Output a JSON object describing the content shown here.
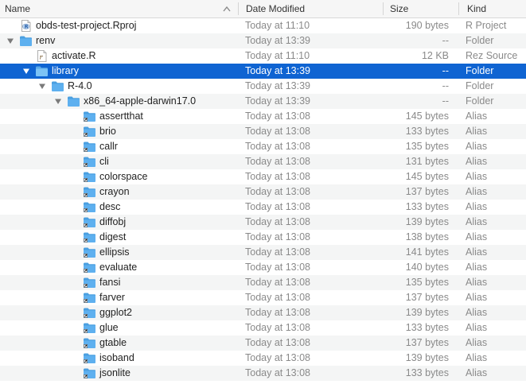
{
  "header": {
    "name": "Name",
    "date_modified": "Date Modified",
    "size": "Size",
    "kind": "Kind"
  },
  "colors": {
    "selection": "#0f64d2",
    "folder": "#5eb0ef",
    "alt_row": "#f4f5f5"
  },
  "rows": [
    {
      "name": "obds-test-project.Rproj",
      "date": "Today at 11:10",
      "size": "190 bytes",
      "kind": "R Project",
      "indent": 0,
      "icon": "rproj-file-icon",
      "expand": "none"
    },
    {
      "name": "renv",
      "date": "Today at 13:39",
      "size": "--",
      "kind": "Folder",
      "indent": 0,
      "icon": "folder-icon",
      "expand": "open"
    },
    {
      "name": "activate.R",
      "date": "Today at 11:10",
      "size": "12 KB",
      "kind": "Rez Source",
      "indent": 1,
      "icon": "r-source-file-icon",
      "expand": "none"
    },
    {
      "name": "library",
      "date": "Today at 13:39",
      "size": "--",
      "kind": "Folder",
      "indent": 1,
      "icon": "folder-icon",
      "expand": "open",
      "selected": true
    },
    {
      "name": "R-4.0",
      "date": "Today at 13:39",
      "size": "--",
      "kind": "Folder",
      "indent": 2,
      "icon": "folder-icon",
      "expand": "open"
    },
    {
      "name": "x86_64-apple-darwin17.0",
      "date": "Today at 13:39",
      "size": "--",
      "kind": "Folder",
      "indent": 3,
      "icon": "folder-icon",
      "expand": "open"
    },
    {
      "name": "assertthat",
      "date": "Today at 13:08",
      "size": "145 bytes",
      "kind": "Alias",
      "indent": 4,
      "icon": "folder-alias-icon",
      "expand": "none"
    },
    {
      "name": "brio",
      "date": "Today at 13:08",
      "size": "133 bytes",
      "kind": "Alias",
      "indent": 4,
      "icon": "folder-alias-icon",
      "expand": "none"
    },
    {
      "name": "callr",
      "date": "Today at 13:08",
      "size": "135 bytes",
      "kind": "Alias",
      "indent": 4,
      "icon": "folder-alias-icon",
      "expand": "none"
    },
    {
      "name": "cli",
      "date": "Today at 13:08",
      "size": "131 bytes",
      "kind": "Alias",
      "indent": 4,
      "icon": "folder-alias-icon",
      "expand": "none"
    },
    {
      "name": "colorspace",
      "date": "Today at 13:08",
      "size": "145 bytes",
      "kind": "Alias",
      "indent": 4,
      "icon": "folder-alias-icon",
      "expand": "none"
    },
    {
      "name": "crayon",
      "date": "Today at 13:08",
      "size": "137 bytes",
      "kind": "Alias",
      "indent": 4,
      "icon": "folder-alias-icon",
      "expand": "none"
    },
    {
      "name": "desc",
      "date": "Today at 13:08",
      "size": "133 bytes",
      "kind": "Alias",
      "indent": 4,
      "icon": "folder-alias-icon",
      "expand": "none"
    },
    {
      "name": "diffobj",
      "date": "Today at 13:08",
      "size": "139 bytes",
      "kind": "Alias",
      "indent": 4,
      "icon": "folder-alias-icon",
      "expand": "none"
    },
    {
      "name": "digest",
      "date": "Today at 13:08",
      "size": "138 bytes",
      "kind": "Alias",
      "indent": 4,
      "icon": "folder-alias-icon",
      "expand": "none"
    },
    {
      "name": "ellipsis",
      "date": "Today at 13:08",
      "size": "141 bytes",
      "kind": "Alias",
      "indent": 4,
      "icon": "folder-alias-icon",
      "expand": "none"
    },
    {
      "name": "evaluate",
      "date": "Today at 13:08",
      "size": "140 bytes",
      "kind": "Alias",
      "indent": 4,
      "icon": "folder-alias-icon",
      "expand": "none"
    },
    {
      "name": "fansi",
      "date": "Today at 13:08",
      "size": "135 bytes",
      "kind": "Alias",
      "indent": 4,
      "icon": "folder-alias-icon",
      "expand": "none"
    },
    {
      "name": "farver",
      "date": "Today at 13:08",
      "size": "137 bytes",
      "kind": "Alias",
      "indent": 4,
      "icon": "folder-alias-icon",
      "expand": "none"
    },
    {
      "name": "ggplot2",
      "date": "Today at 13:08",
      "size": "139 bytes",
      "kind": "Alias",
      "indent": 4,
      "icon": "folder-alias-icon",
      "expand": "none"
    },
    {
      "name": "glue",
      "date": "Today at 13:08",
      "size": "133 bytes",
      "kind": "Alias",
      "indent": 4,
      "icon": "folder-alias-icon",
      "expand": "none"
    },
    {
      "name": "gtable",
      "date": "Today at 13:08",
      "size": "137 bytes",
      "kind": "Alias",
      "indent": 4,
      "icon": "folder-alias-icon",
      "expand": "none"
    },
    {
      "name": "isoband",
      "date": "Today at 13:08",
      "size": "139 bytes",
      "kind": "Alias",
      "indent": 4,
      "icon": "folder-alias-icon",
      "expand": "none"
    },
    {
      "name": "jsonlite",
      "date": "Today at 13:08",
      "size": "133 bytes",
      "kind": "Alias",
      "indent": 4,
      "icon": "folder-alias-icon",
      "expand": "none"
    }
  ]
}
